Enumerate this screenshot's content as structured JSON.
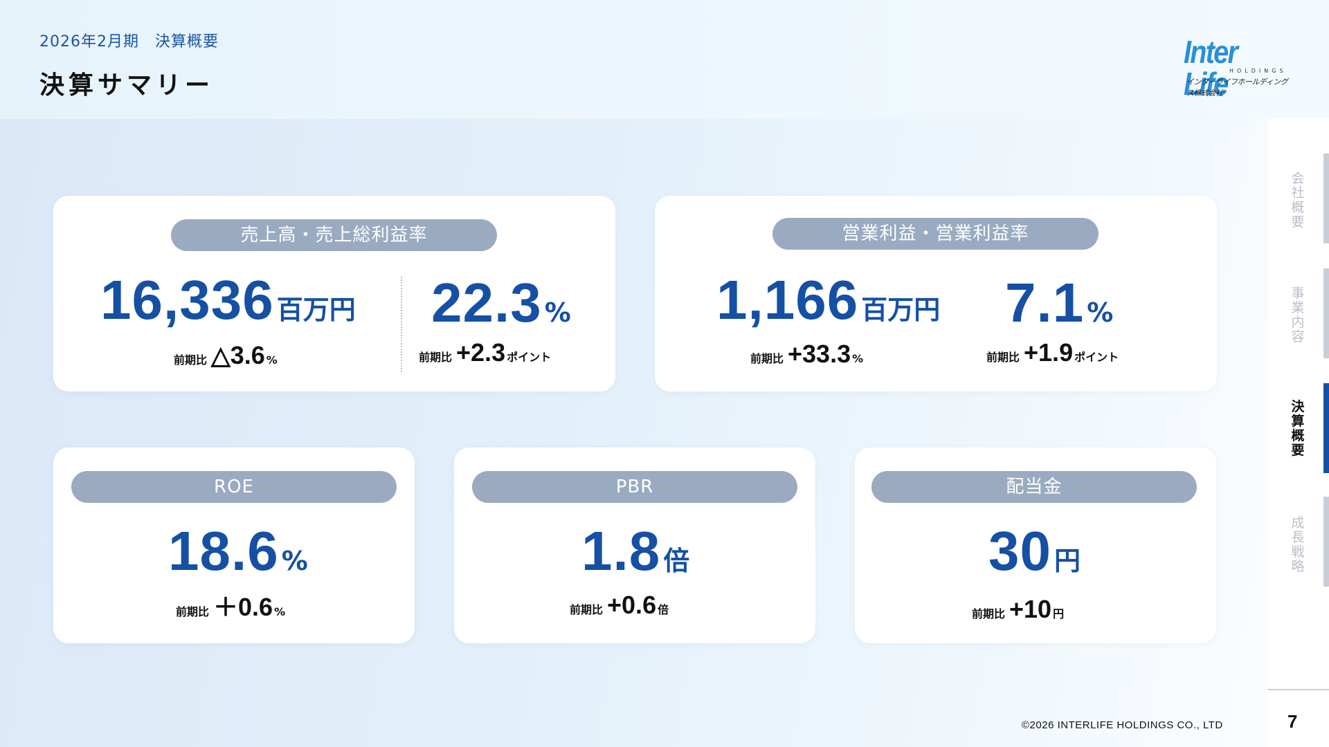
{
  "header": {
    "kicker": "2026年2月期　決算概要",
    "title": "決算サマリー"
  },
  "logo": {
    "main": "Inter Life",
    "sub": "HOLDINGS",
    "jp": "インターライフホールディングス株式会社"
  },
  "cards": {
    "sales": {
      "label": "売上高・売上総利益率",
      "left": {
        "value": "16,336",
        "unit": "百万円",
        "cmp_label": "前期比",
        "cmp_value": "△3.6",
        "cmp_unit": "%"
      },
      "right": {
        "value": "22.3",
        "unit": "%",
        "cmp_label": "前期比",
        "cmp_value": "+2.3",
        "cmp_unit": "ポイント"
      }
    },
    "operating": {
      "label": "営業利益・営業利益率",
      "left": {
        "value": "1,166",
        "unit": "百万円",
        "cmp_label": "前期比",
        "cmp_value": "+33.3",
        "cmp_unit": "%"
      },
      "right": {
        "value": "7.1",
        "unit": "%",
        "cmp_label": "前期比",
        "cmp_value": "+1.9",
        "cmp_unit": "ポイント"
      }
    },
    "roe": {
      "label": "ROE",
      "value": "18.6",
      "unit": "%",
      "cmp_label": "前期比",
      "cmp_value": "＋0.6",
      "cmp_unit": "%"
    },
    "pbr": {
      "label": "PBR",
      "value": "1.8",
      "unit": "倍",
      "cmp_label": "前期比",
      "cmp_value": "+0.6",
      "cmp_unit": "倍"
    },
    "dividend": {
      "label": "配当金",
      "value": "30",
      "unit": "円",
      "cmp_label": "前期比",
      "cmp_value": "+10",
      "cmp_unit": "円"
    }
  },
  "sidebar": {
    "items": [
      {
        "label": "会社概要",
        "active": false
      },
      {
        "label": "事業内容",
        "active": false
      },
      {
        "label": "決算概要",
        "active": true
      },
      {
        "label": "成長戦略",
        "active": false
      }
    ]
  },
  "footer": {
    "copyright": "©2026 INTERLIFE HOLDINGS CO., LTD",
    "page_number": "7"
  },
  "colors": {
    "accent": "#1550a4",
    "pill": "#9aabc1",
    "logo": "#2a8fd6"
  }
}
